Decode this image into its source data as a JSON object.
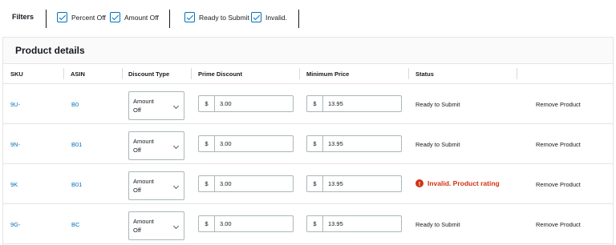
{
  "filters": {
    "label": "Filters",
    "options": [
      {
        "label": "Percent Off",
        "checked": true
      },
      {
        "label": "Amount Off",
        "checked": true
      },
      {
        "label": "Ready to Submit",
        "checked": true
      },
      {
        "label": "Invalid.",
        "checked": true
      }
    ]
  },
  "panel": {
    "title": "Product details",
    "columns": [
      "SKU",
      "ASIN",
      "Discount Type",
      "Prime Discount",
      "Minimum Price",
      "Status"
    ],
    "currency_symbol": "$",
    "remove_label": "Remove Product",
    "rows": [
      {
        "sku": "9U-",
        "asin": "B0",
        "discount_type": "Amount Off",
        "prime_discount": "3.00",
        "minimum_price": "13.95",
        "status": "Ready to Submit",
        "status_kind": "ok"
      },
      {
        "sku": "9N-",
        "asin": "B01",
        "discount_type": "Amount Off",
        "prime_discount": "3.00",
        "minimum_price": "13.95",
        "status": "Ready to Submit",
        "status_kind": "ok"
      },
      {
        "sku": "9K",
        "asin": "B01",
        "discount_type": "Amount Off",
        "prime_discount": "3.00",
        "minimum_price": "13.95",
        "status": "Invalid. Product rating",
        "status_kind": "error",
        "status_icon": "error-icon"
      },
      {
        "sku": "9G-",
        "asin": "BC",
        "discount_type": "Amount Off",
        "prime_discount": "3.00",
        "minimum_price": "13.95",
        "status": "Ready to Submit",
        "status_kind": "ok"
      }
    ]
  },
  "colors": {
    "link": "#0073bb",
    "error": "#d13212",
    "border": "#e5e5e5"
  }
}
